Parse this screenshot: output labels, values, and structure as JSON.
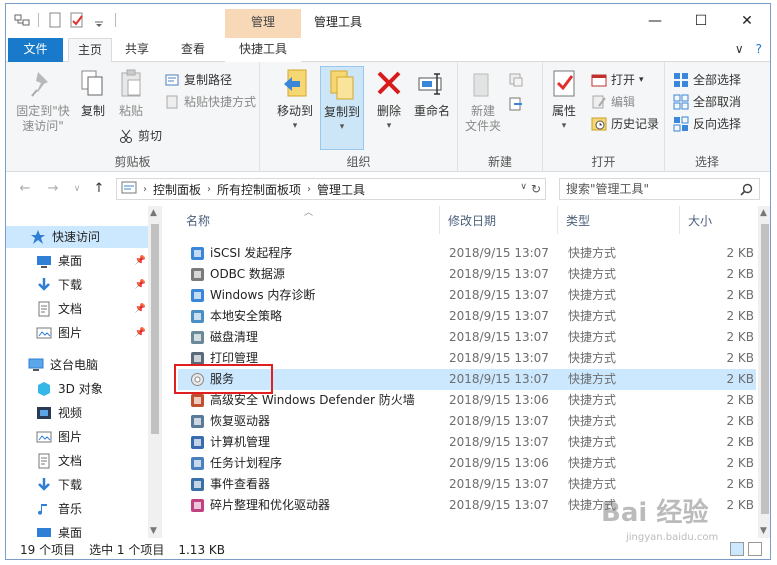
{
  "window": {
    "title": "管理工具",
    "context_tab_head": "管理",
    "controls": {
      "minimize": "—",
      "maximize": "☐",
      "close": "✕"
    }
  },
  "tabs": [
    {
      "label": "文件"
    },
    {
      "label": "主页"
    },
    {
      "label": "共享"
    },
    {
      "label": "查看"
    },
    {
      "label": "快捷工具"
    }
  ],
  "tabs_right": {
    "collapse": "∨",
    "help": "?"
  },
  "ribbon": {
    "clipboard": {
      "label": "剪贴板",
      "pin_quick_access": "固定到\"快\n速访问\"",
      "copy": "复制",
      "paste": "粘贴",
      "copy_path": "复制路径",
      "paste_shortcut": "粘贴快捷方式",
      "cut": "剪切"
    },
    "organize": {
      "label": "组织",
      "move_to": "移动到",
      "copy_to": "复制到",
      "delete": "删除",
      "rename": "重命名"
    },
    "new": {
      "label": "新建",
      "new_folder": "新建\n文件夹"
    },
    "open": {
      "label": "打开",
      "properties": "属性",
      "open": "打开",
      "edit": "编辑",
      "history": "历史记录"
    },
    "select": {
      "label": "选择",
      "select_all": "全部选择",
      "select_none": "全部取消",
      "invert": "反向选择"
    }
  },
  "address": {
    "crumbs": [
      "控制面板",
      "所有控制面板项",
      "管理工具"
    ],
    "search_placeholder": "搜索\"管理工具\""
  },
  "nav": {
    "items": [
      {
        "label": "快速访问",
        "pinned": false
      },
      {
        "label": "桌面",
        "pinned": true
      },
      {
        "label": "下载",
        "pinned": true
      },
      {
        "label": "文档",
        "pinned": true
      },
      {
        "label": "图片",
        "pinned": true
      },
      {
        "label": "这台电脑",
        "pinned": false
      },
      {
        "label": "3D 对象",
        "pinned": false
      },
      {
        "label": "视频",
        "pinned": false
      },
      {
        "label": "图片",
        "pinned": false
      },
      {
        "label": "文档",
        "pinned": false
      },
      {
        "label": "下载",
        "pinned": false
      },
      {
        "label": "音乐",
        "pinned": false
      },
      {
        "label": "桌面",
        "pinned": false
      }
    ]
  },
  "columns": {
    "name": "名称",
    "date": "修改日期",
    "type": "类型",
    "size": "大小"
  },
  "files": [
    {
      "name": "iSCSI 发起程序",
      "date": "2018/9/15 13:07",
      "type": "快捷方式",
      "size": "2 KB"
    },
    {
      "name": "ODBC 数据源",
      "date": "2018/9/15 13:07",
      "type": "快捷方式",
      "size": "2 KB"
    },
    {
      "name": "Windows 内存诊断",
      "date": "2018/9/15 13:07",
      "type": "快捷方式",
      "size": "2 KB"
    },
    {
      "name": "本地安全策略",
      "date": "2018/9/15 13:07",
      "type": "快捷方式",
      "size": "2 KB"
    },
    {
      "name": "磁盘清理",
      "date": "2018/9/15 13:07",
      "type": "快捷方式",
      "size": "2 KB"
    },
    {
      "name": "打印管理",
      "date": "2018/9/15 13:07",
      "type": "快捷方式",
      "size": "2 KB"
    },
    {
      "name": "服务",
      "date": "2018/9/15 13:07",
      "type": "快捷方式",
      "size": "2 KB"
    },
    {
      "name": "高级安全 Windows Defender 防火墙",
      "date": "2018/9/15 13:06",
      "type": "快捷方式",
      "size": "2 KB"
    },
    {
      "name": "恢复驱动器",
      "date": "2018/9/15 13:07",
      "type": "快捷方式",
      "size": "2 KB"
    },
    {
      "name": "计算机管理",
      "date": "2018/9/15 13:07",
      "type": "快捷方式",
      "size": "2 KB"
    },
    {
      "name": "任务计划程序",
      "date": "2018/9/15 13:06",
      "type": "快捷方式",
      "size": "2 KB"
    },
    {
      "name": "事件查看器",
      "date": "2018/9/15 13:07",
      "type": "快捷方式",
      "size": "2 KB"
    },
    {
      "name": "碎片整理和优化驱动器",
      "date": "2018/9/15 13:07",
      "type": "快捷方式",
      "size": "2 KB"
    }
  ],
  "selected_index": 6,
  "status": {
    "count": "19 个项目",
    "selected": "选中 1 个项目",
    "size": "1.13 KB"
  },
  "watermark": {
    "main": "Bai 经验",
    "sub": "jingyan.baidu.com"
  },
  "colors": {
    "accent": "#1979ca",
    "selection": "#cce8ff",
    "context_tab": "#f8d9b7",
    "highlight": "#e02020"
  }
}
